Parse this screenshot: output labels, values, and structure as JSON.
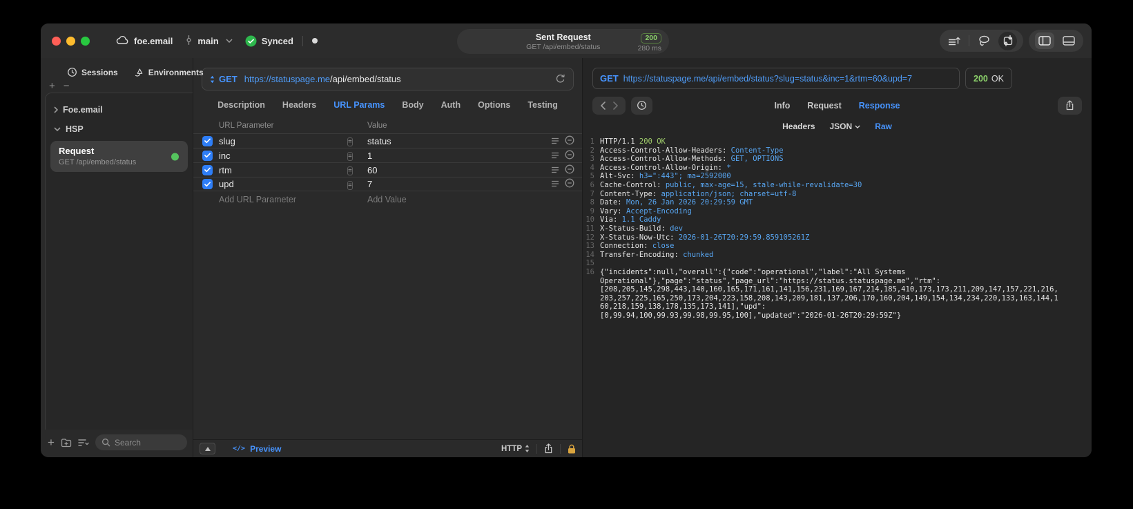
{
  "accents": {
    "blue": "#4794ff",
    "url_blue": "#4f9cf8",
    "green": "#8bd06a",
    "sync_green": "#2eb84d",
    "checkbox_blue": "#2e7ef7",
    "lock_gold": "#d9a43e"
  },
  "titlebar": {
    "project": "foe.email",
    "branch": "main",
    "sync_status": "Synced",
    "request_title": "Sent Request",
    "request_subtitle": "GET /api/embed/status",
    "status_code": "200",
    "duration": "280 ms"
  },
  "sidebar": {
    "tabs": [
      {
        "label": "Sessions"
      },
      {
        "label": "Environments"
      }
    ],
    "add_label": "+",
    "remove_label": "−",
    "tree": [
      {
        "label": "Foe.email"
      },
      {
        "label": "HSP"
      }
    ],
    "request_item": {
      "title": "Request",
      "subtitle": "GET /api/embed/status"
    },
    "search_placeholder": "Search"
  },
  "request_editor": {
    "method": "GET",
    "url_host": "https://statuspage.me",
    "url_path": "/api/embed/status",
    "tabs": [
      "Description",
      "Headers",
      "URL Params",
      "Body",
      "Auth",
      "Options",
      "Testing"
    ],
    "active_tab": "URL Params",
    "params": {
      "col_name": "URL Parameter",
      "col_value": "Value",
      "rows": [
        {
          "name": "slug",
          "value": "status",
          "checked": true
        },
        {
          "name": "inc",
          "value": "1",
          "checked": true
        },
        {
          "name": "rtm",
          "value": "60",
          "checked": true
        },
        {
          "name": "upd",
          "value": "7",
          "checked": true
        }
      ],
      "add_name_placeholder": "Add URL Parameter",
      "add_value_placeholder": "Add Value"
    },
    "footer": {
      "preview_label": "Preview",
      "code_glyph": "</>",
      "protocol": "HTTP"
    }
  },
  "response_viewer": {
    "method": "GET",
    "url": "https://statuspage.me/api/embed/status?slug=status&inc=1&rtm=60&upd=7",
    "status": "200",
    "status_text": "OK",
    "tabs": [
      "Info",
      "Request",
      "Response"
    ],
    "active_tab": "Response",
    "view_tabs": [
      {
        "label": "Headers"
      },
      {
        "label": "JSON",
        "dropdown": true
      },
      {
        "label": "Raw",
        "active": true
      }
    ],
    "lines": [
      {
        "n": "1",
        "spans": [
          {
            "t": "HTTP/1.1 ",
            "c": "w"
          },
          {
            "t": "200 OK",
            "c": "g"
          }
        ]
      },
      {
        "n": "2",
        "spans": [
          {
            "t": "Access-Control-Allow-Headers: ",
            "c": "w"
          },
          {
            "t": "Content-Type",
            "c": "b"
          }
        ]
      },
      {
        "n": "3",
        "spans": [
          {
            "t": "Access-Control-Allow-Methods: ",
            "c": "w"
          },
          {
            "t": "GET, OPTIONS",
            "c": "b"
          }
        ]
      },
      {
        "n": "4",
        "spans": [
          {
            "t": "Access-Control-Allow-Origin: ",
            "c": "w"
          },
          {
            "t": "*",
            "c": "b"
          }
        ]
      },
      {
        "n": "5",
        "spans": [
          {
            "t": "Alt-Svc: ",
            "c": "w"
          },
          {
            "t": "h3=\":443\"; ma=2592000",
            "c": "b"
          }
        ]
      },
      {
        "n": "6",
        "spans": [
          {
            "t": "Cache-Control: ",
            "c": "w"
          },
          {
            "t": "public, max-age=15, stale-while-revalidate=30",
            "c": "b"
          }
        ]
      },
      {
        "n": "7",
        "spans": [
          {
            "t": "Content-Type: ",
            "c": "w"
          },
          {
            "t": "application/json; charset=utf-8",
            "c": "b"
          }
        ]
      },
      {
        "n": "8",
        "spans": [
          {
            "t": "Date: ",
            "c": "w"
          },
          {
            "t": "Mon, 26 Jan 2026 20:29:59 GMT",
            "c": "b"
          }
        ]
      },
      {
        "n": "9",
        "spans": [
          {
            "t": "Vary: ",
            "c": "w"
          },
          {
            "t": "Accept-Encoding",
            "c": "b"
          }
        ]
      },
      {
        "n": "10",
        "spans": [
          {
            "t": "Via: ",
            "c": "w"
          },
          {
            "t": "1.1 Caddy",
            "c": "b"
          }
        ]
      },
      {
        "n": "11",
        "spans": [
          {
            "t": "X-Status-Build: ",
            "c": "w"
          },
          {
            "t": "dev",
            "c": "b"
          }
        ]
      },
      {
        "n": "12",
        "spans": [
          {
            "t": "X-Status-Now-Utc: ",
            "c": "w"
          },
          {
            "t": "2026-01-26T20:29:59.859105261Z",
            "c": "b"
          }
        ]
      },
      {
        "n": "13",
        "spans": [
          {
            "t": "Connection: ",
            "c": "w"
          },
          {
            "t": "close",
            "c": "b"
          }
        ]
      },
      {
        "n": "14",
        "spans": [
          {
            "t": "Transfer-Encoding: ",
            "c": "w"
          },
          {
            "t": "chunked",
            "c": "b"
          }
        ]
      },
      {
        "n": "15",
        "spans": []
      },
      {
        "n": "16",
        "spans": [
          {
            "t": "{\"incidents\":null,\"overall\":{\"code\":\"operational\",\"label\":\"All Systems",
            "c": "w"
          }
        ]
      },
      {
        "n": "",
        "spans": [
          {
            "t": "Operational\"},\"page\":\"status\",\"page_url\":\"https://status.statuspage.me\",\"rtm\":",
            "c": "w"
          }
        ]
      },
      {
        "n": "",
        "spans": [
          {
            "t": "[208,205,145,298,443,140,160,165,171,161,141,156,231,169,167,214,185,410,173,173,211,209,147,157,221,216,",
            "c": "w"
          }
        ]
      },
      {
        "n": "",
        "spans": [
          {
            "t": "203,257,225,165,250,173,204,223,158,208,143,209,181,137,206,170,160,204,149,154,134,234,220,133,163,144,1",
            "c": "w"
          }
        ]
      },
      {
        "n": "",
        "spans": [
          {
            "t": "60,218,159,138,178,135,173,141],\"upd\":",
            "c": "w"
          }
        ]
      },
      {
        "n": "",
        "spans": [
          {
            "t": "[0,99.94,100,99.93,99.98,99.95,100],\"updated\":\"2026-01-26T20:29:59Z\"}",
            "c": "w"
          }
        ]
      }
    ]
  }
}
